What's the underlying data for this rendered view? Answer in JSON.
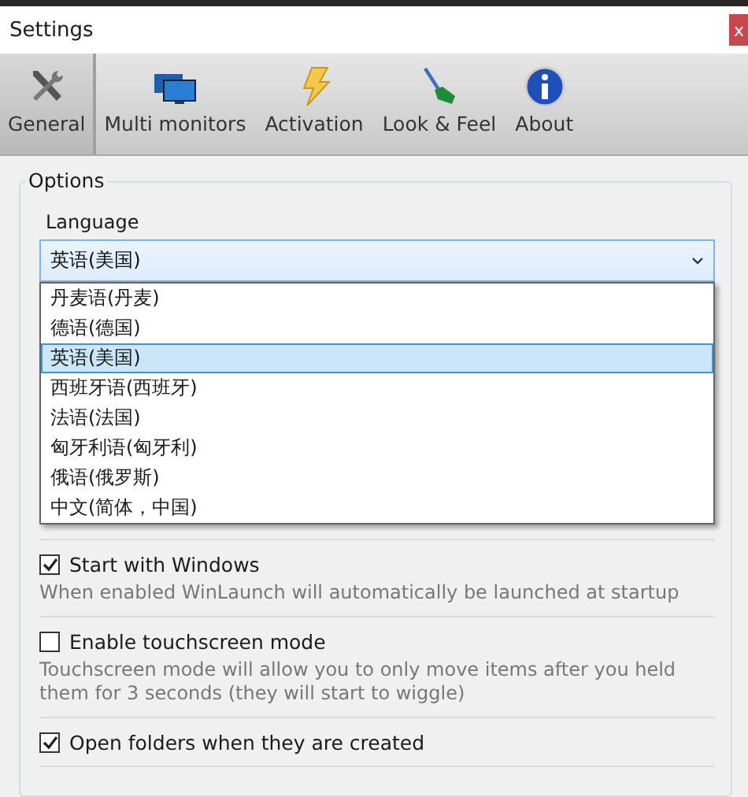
{
  "window": {
    "title": "Settings",
    "close": "x"
  },
  "tabs": [
    {
      "label": "General",
      "kind": "tools",
      "selected": true
    },
    {
      "label": "Multi monitors",
      "kind": "monitor",
      "selected": false
    },
    {
      "label": "Activation",
      "kind": "bolt",
      "selected": false
    },
    {
      "label": "Look & Feel",
      "kind": "brush",
      "selected": false
    },
    {
      "label": "About",
      "kind": "info",
      "selected": false
    }
  ],
  "options": {
    "title": "Options",
    "language": {
      "label": "Language",
      "value": "英语(美国)",
      "expanded": true,
      "items": [
        {
          "label": "丹麦语(丹麦)",
          "selected": false
        },
        {
          "label": "德语(德国)",
          "selected": false
        },
        {
          "label": "英语(美国)",
          "selected": true
        },
        {
          "label": "西班牙语(西班牙)",
          "selected": false
        },
        {
          "label": "法语(法国)",
          "selected": false
        },
        {
          "label": "匈牙利语(匈牙利)",
          "selected": false
        },
        {
          "label": "俄语(俄罗斯)",
          "selected": false
        },
        {
          "label": "中文(简体，中国)",
          "selected": false
        }
      ]
    },
    "settings": [
      {
        "label": "Start with Windows",
        "checked": true,
        "description": "When enabled WinLaunch will automatically be launched at startup"
      },
      {
        "label": "Enable touchscreen mode",
        "checked": false,
        "description": "Touchscreen mode will allow you to only move items after you held them for 3 seconds (they will start to wiggle)"
      },
      {
        "label": "Open folders when they are created",
        "checked": true
      }
    ]
  }
}
